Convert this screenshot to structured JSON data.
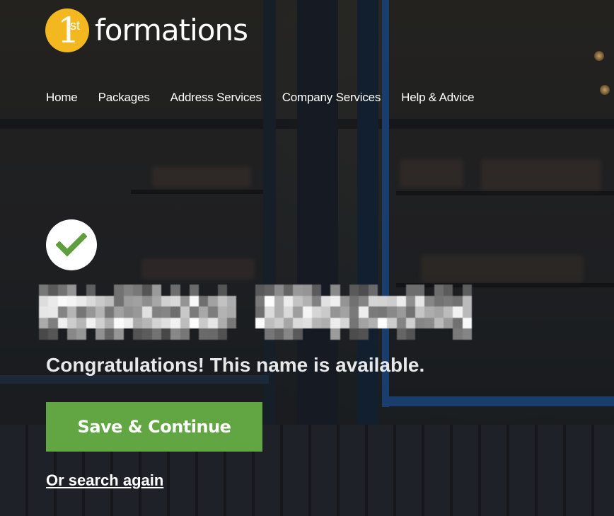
{
  "brand": {
    "badge_number": "1",
    "badge_suffix": "st",
    "wordmark": "formations",
    "badge_color": "#f3b820"
  },
  "nav": {
    "items": [
      {
        "label": "Home"
      },
      {
        "label": "Packages"
      },
      {
        "label": "Address Services"
      },
      {
        "label": "Company Services"
      },
      {
        "label": "Help & Advice"
      }
    ]
  },
  "result": {
    "status_icon": "checkmark-icon",
    "check_color": "#5e9e3d",
    "message": "Congratulations! This name is available."
  },
  "actions": {
    "primary_label": "Save & Continue",
    "primary_color": "#62a543",
    "secondary_label": "Or search again"
  }
}
